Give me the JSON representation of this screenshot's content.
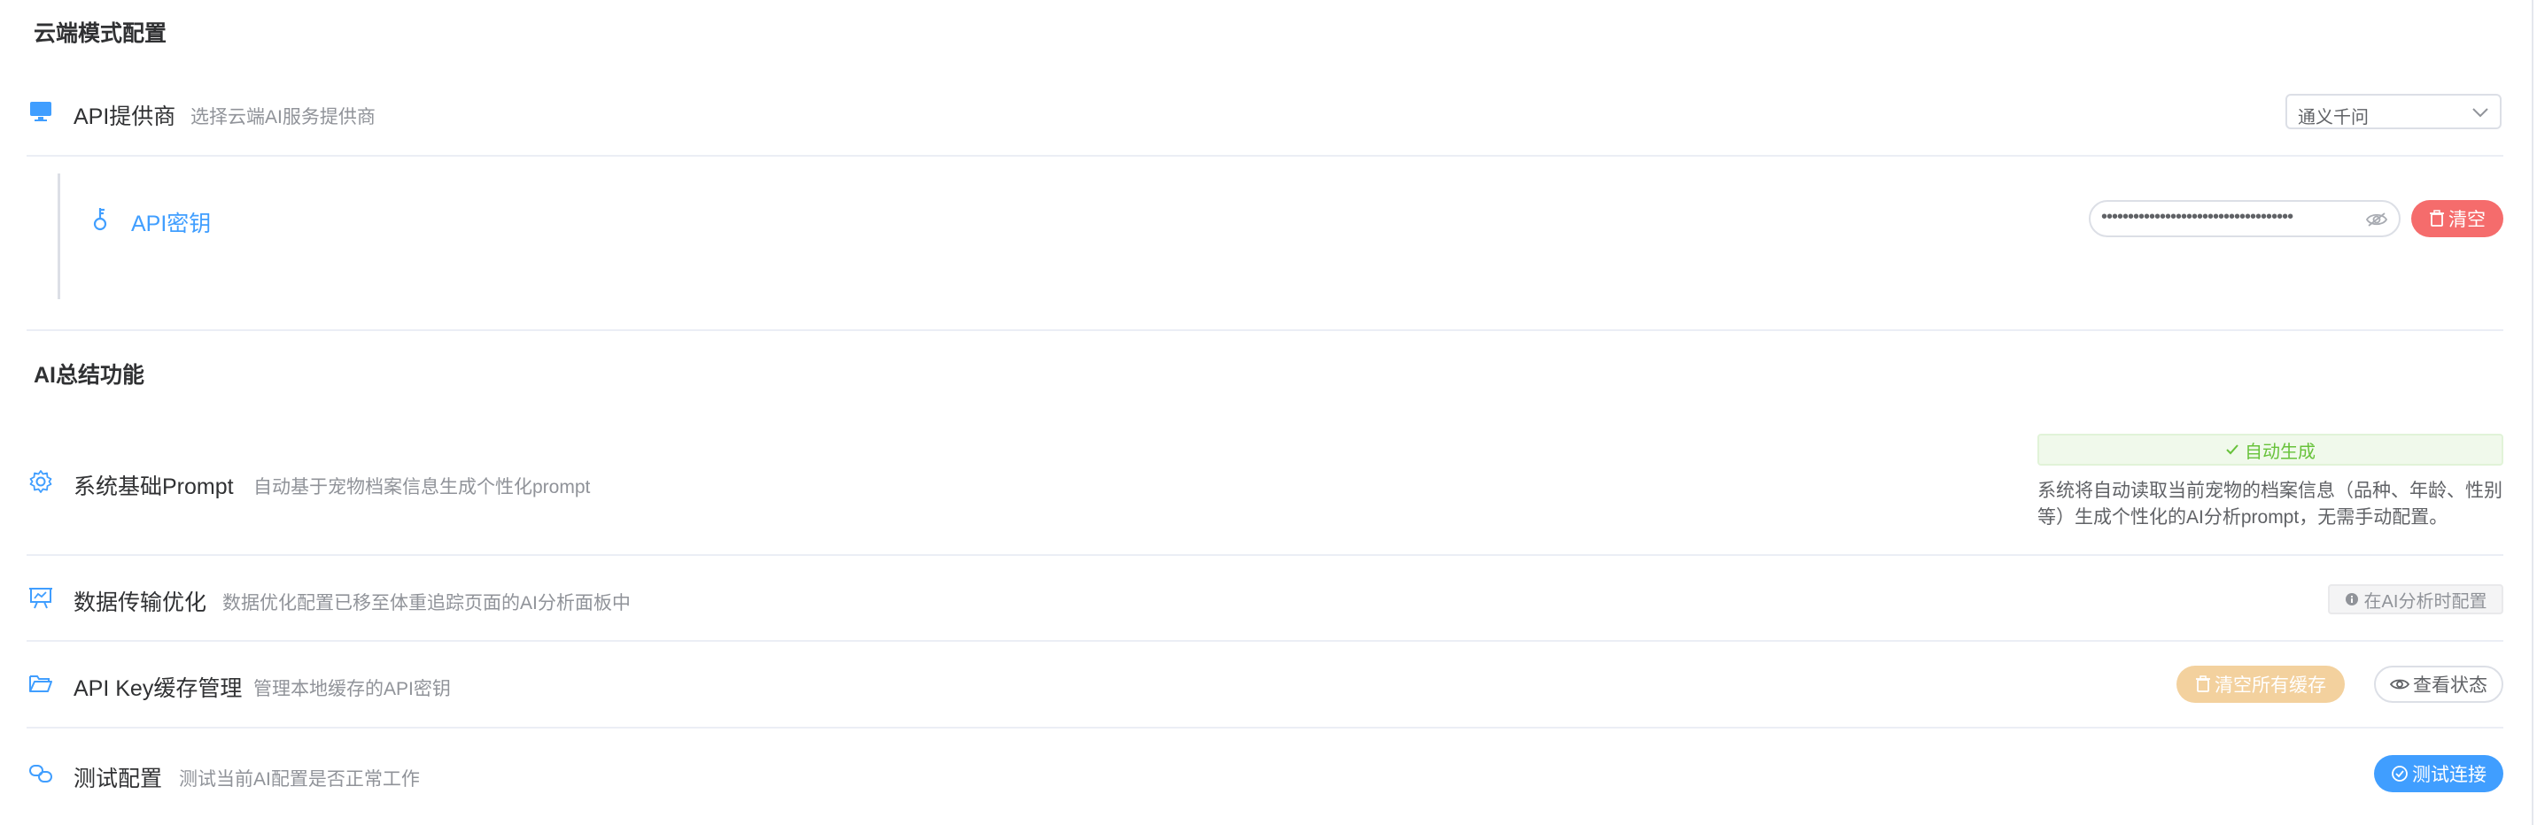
{
  "cloud_section": {
    "title": "云端模式配置",
    "provider": {
      "icon": "monitor-icon",
      "label": "API提供商",
      "desc": "选择云端AI服务提供商",
      "selected": "通义千问"
    },
    "api_key": {
      "icon": "key-icon",
      "label": "API密钥",
      "masked_value": "••••••••••••••••••••••••••••••••••••",
      "clear_label": "清空"
    }
  },
  "ai_section": {
    "title": "AI总结功能",
    "prompt": {
      "icon": "gear-icon",
      "label": "系统基础Prompt",
      "desc": "自动基于宠物档案信息生成个性化prompt",
      "tag": "自动生成",
      "note": "系统将自动读取当前宠物的档案信息（品种、年龄、性别等）生成个性化的AI分析prompt，无需手动配置。"
    },
    "transfer": {
      "icon": "presentation-icon",
      "label": "数据传输优化",
      "desc": "数据优化配置已移至体重追踪页面的AI分析面板中",
      "tag": "在AI分析时配置"
    },
    "cache": {
      "icon": "folder-open-icon",
      "label": "API Key缓存管理",
      "desc": "管理本地缓存的API密钥",
      "clear_all_label": "清空所有缓存",
      "view_label": "查看状态"
    },
    "test": {
      "icon": "link-icon",
      "label": "测试配置",
      "desc": "测试当前AI配置是否正常工作",
      "test_label": "测试连接"
    }
  },
  "colors": {
    "primary": "#409eff",
    "danger": "#f56c6c",
    "warning_light": "#f3d19e",
    "success": "#67c23a",
    "text": "#303133",
    "muted": "#909399"
  }
}
